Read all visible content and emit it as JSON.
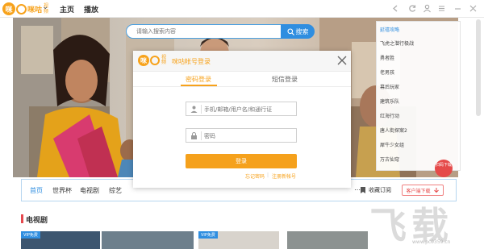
{
  "titlebar": {
    "logo_text": "咪咕",
    "logo_sub": "视频",
    "tabs": [
      "主页",
      "播放"
    ]
  },
  "search": {
    "placeholder": "请输入搜索内容",
    "button_label": "搜索"
  },
  "right_list": {
    "items": [
      "延禧攻略",
      "飞虎之潜行极战",
      "勇者胜",
      "老男孩",
      "幕后玩家",
      "建筑乐队",
      "红海行动",
      "唐人街探案2",
      "犀牛少女组",
      "万古仙穹"
    ]
  },
  "download_badge": "扫码下载",
  "nav": {
    "items": [
      "首页",
      "世界杯",
      "电视剧",
      "综艺"
    ],
    "right_items": [
      "收藏订阅"
    ],
    "client_button": "客户端下载"
  },
  "section": {
    "title": "电视剧",
    "vip_label": "VIP免费"
  },
  "modal": {
    "title": "咪咕帐号登录",
    "tabs": [
      "密码登录",
      "短信登录"
    ],
    "username_placeholder": "手机/邮箱/用户名/和通行证",
    "password_placeholder": "密码",
    "login_button": "登录",
    "forgot_link": "忘记密码",
    "divider": "|",
    "register_link": "注册新帐号"
  },
  "watermark": {
    "site": "www.pc0359.cn"
  },
  "colors": {
    "brand_orange": "#f7a21b",
    "accent_blue": "#2f8ee0",
    "badge_red": "#e54a4a"
  }
}
